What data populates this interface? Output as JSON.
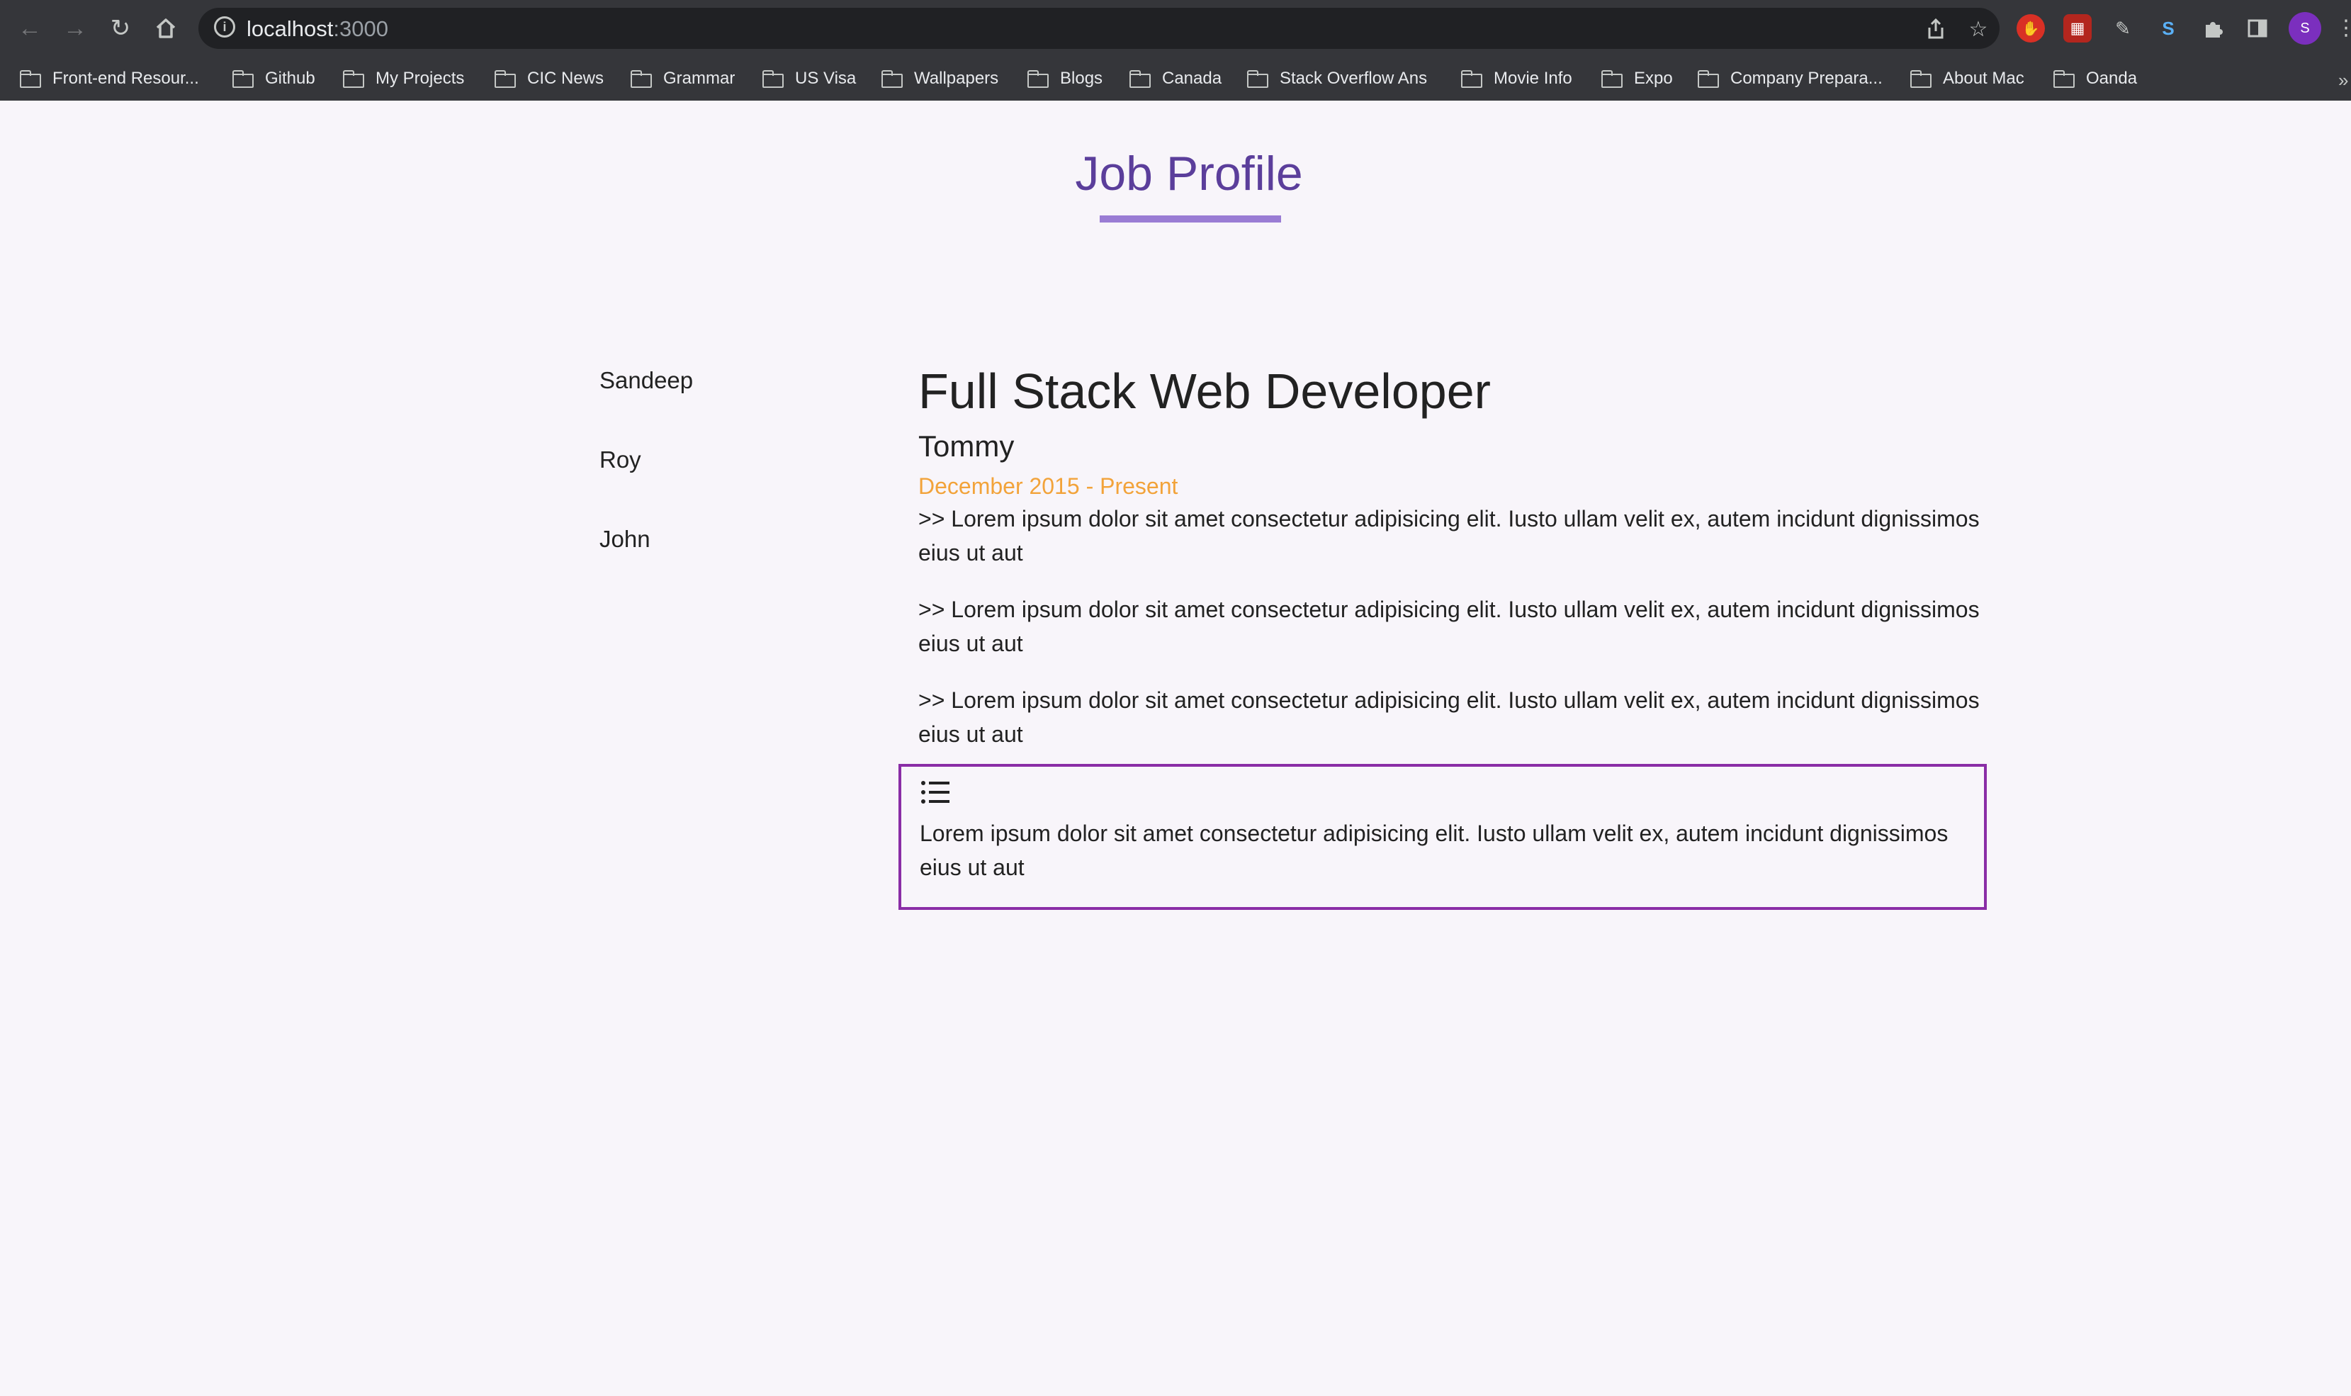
{
  "browser": {
    "url_host": "localhost",
    "url_port": ":3000",
    "bookmarks": [
      "Front-end Resour...",
      "Github",
      "My Projects",
      "CIC News",
      "Grammar",
      "US Visa",
      "Wallpapers",
      "Blogs",
      "Canada",
      "Stack Overflow Ans",
      "Movie Info",
      "Expo",
      "Company Prepara...",
      "About Mac",
      "Oanda"
    ],
    "bookmarks_overflow": "»",
    "avatar_initial": "S"
  },
  "page": {
    "title": "Job Profile",
    "people": [
      "Sandeep",
      "Roy",
      "John"
    ],
    "job": {
      "title": "Full Stack Web Developer",
      "company": "Tommy",
      "dates": "December 2015 - Present",
      "duties": [
        ">> Lorem ipsum dolor sit amet consectetur adipisicing elit. Iusto ullam velit ex, autem incidunt dignissimos eius ut aut",
        ">> Lorem ipsum dolor sit amet consectetur adipisicing elit. Iusto ullam velit ex, autem incidunt dignissimos eius ut aut",
        ">> Lorem ipsum dolor sit amet consectetur adipisicing elit. Iusto ullam velit ex, autem incidunt dignissimos eius ut aut"
      ],
      "highlighted_duty": "Lorem ipsum dolor sit amet consectetur adipisicing elit. Iusto ullam velit ex, autem incidunt dignissimos eius ut aut"
    }
  },
  "colors": {
    "title": "#5b3e9b",
    "underline": "#9a7cd4",
    "dates": "#f2a33a",
    "highlight_border": "#8a2da6",
    "page_bg": "#f8f5fa"
  },
  "icons": {
    "back": "arrow-left-icon",
    "forward": "arrow-right-icon",
    "reload": "reload-icon",
    "home": "home-icon",
    "share": "share-icon",
    "star": "star-icon",
    "extensions": "puzzle-icon",
    "side_panel": "side-panel-icon",
    "list": "list-icon"
  }
}
